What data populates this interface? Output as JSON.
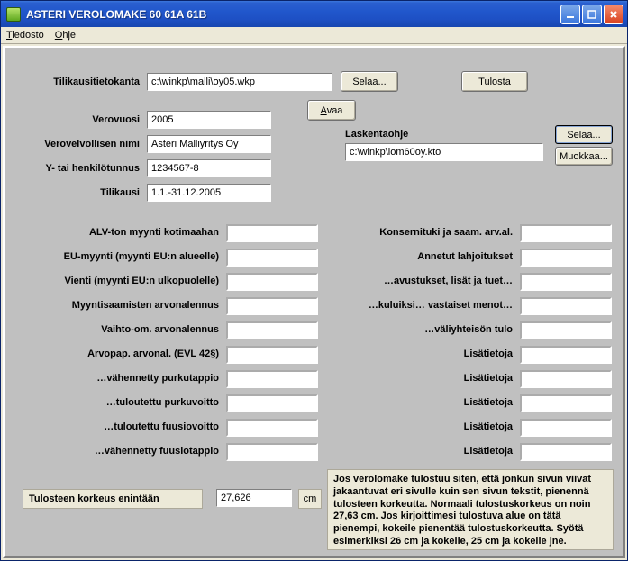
{
  "window": {
    "title": "ASTERI VEROLOMAKE 60 61A 61B"
  },
  "menu": {
    "file": "Tiedosto",
    "file_u": "T",
    "help": "Ohje",
    "help_u": "O"
  },
  "top": {
    "db_label": "Tilikausitietokanta",
    "db_value": "c:\\winkp\\malli\\oy05.wkp",
    "browse": "Selaa...",
    "print": "Tulosta",
    "open": "Avaa",
    "open_u": "A",
    "year_label": "Verovuosi",
    "year_value": "2005",
    "calc_label": "Laskentaohje",
    "calc_value": "c:\\winkp\\lom60oy.kto",
    "browse2": "Selaa...",
    "edit": "Muokkaa...",
    "name_label": "Verovelvollisen nimi",
    "name_value": "Asteri Malliyritys Oy",
    "id_label": "Y- tai henkilötunnus",
    "id_value": "1234567-8",
    "period_label": "Tilikausi",
    "period_value": "1.1.-31.12.2005"
  },
  "left_fields": [
    "ALV-ton myynti kotimaahan",
    "EU-myynti (myynti EU:n alueelle)",
    "Vienti (myynti EU:n ulkopuolelle)",
    "Myyntisaamisten arvonalennus",
    "Vaihto-om. arvonalennus",
    "Arvopap. arvonal. (EVL 42§)",
    "…vähennetty purkutappio",
    "…tuloutettu purkuvoitto",
    "…tuloutettu fuusiovoitto",
    "…vähennetty fuusiotappio"
  ],
  "right_fields": [
    "Konsernituki ja saam. arv.al.",
    "Annetut lahjoitukset",
    "…avustukset, lisät ja tuet…",
    "…kuluiksi… vastaiset menot…",
    "…väliyhteisön tulo",
    "Lisätietoja",
    "Lisätietoja",
    "Lisätietoja",
    "Lisätietoja",
    "Lisätietoja"
  ],
  "footer": {
    "height_label": "Tulosteen korkeus enintään",
    "height_value": "27,626",
    "height_unit": "cm",
    "help": "Jos verolomake tulostuu siten, että jonkun sivun viivat jakaantuvat eri sivulle kuin sen sivun tekstit, pienennä tulosteen korkeutta. Normaali tulostuskorkeus on noin 27,63 cm. Jos kirjoittimesi tulostuva alue on tätä pienempi, kokeile pienentää tulostuskorkeutta. Syötä esimerkiksi 26 cm ja kokeile, 25 cm ja kokeile jne."
  }
}
